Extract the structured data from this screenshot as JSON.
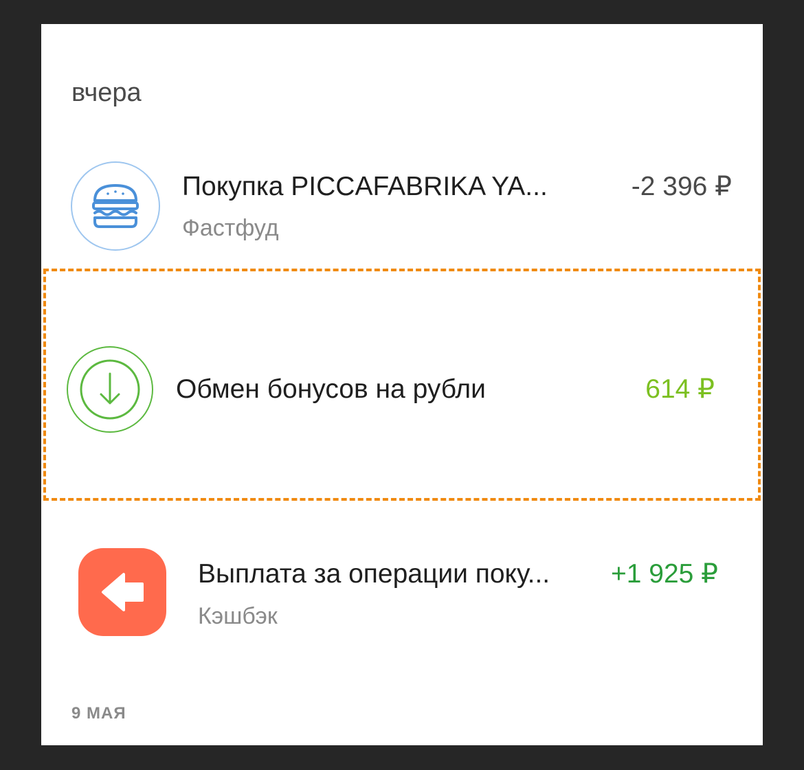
{
  "sections": {
    "yesterday_label": "вчера",
    "next_date_label": "9 МАЯ"
  },
  "transactions": [
    {
      "title": "Покупка PICCAFABRIKA YA...",
      "subtitle": "Фастфуд",
      "amount": "-2 396 ₽",
      "icon": "burger-icon",
      "amount_color": "#4a4a4a"
    },
    {
      "title": "Обмен бонусов на рубли",
      "subtitle": "",
      "amount": "614 ₽",
      "icon": "download-arrow-icon",
      "amount_color": "#7cc021"
    },
    {
      "title": "Выплата за операции поку...",
      "subtitle": "Кэшбэк",
      "amount": "+1 925 ₽",
      "icon": "back-arrow-icon",
      "amount_color": "#2a9d3a"
    }
  ],
  "colors": {
    "highlight": "#f08a10",
    "burger_blue": "#4a90d9",
    "exchange_green": "#5cb940",
    "cashback_orange": "#ff6a4d"
  }
}
